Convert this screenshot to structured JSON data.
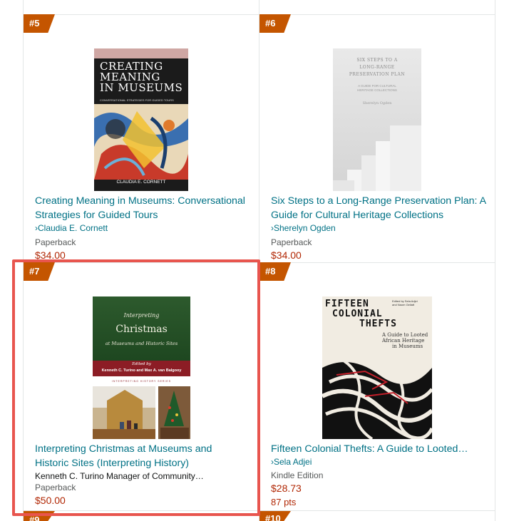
{
  "items": [
    {
      "rank": "#5",
      "title_line1": "Creating Meaning in Museums: Conversational",
      "title_line2": "Strategies for Guided Tours",
      "author": "Claudia E. Cornett",
      "format": "Paperback",
      "price": "$34.00",
      "cover": {
        "title_lines": [
          "CREATING",
          "MEANING",
          "IN MUSEUMS"
        ],
        "subtitle": "CONVERSATIONAL STRATEGIES FOR GUIDED TOURS",
        "author": "CLAUDIA E. CORNETT"
      }
    },
    {
      "rank": "#6",
      "title_line1": "Six Steps to a Long-Range Preservation Plan: A",
      "title_line2": "Guide for Cultural Heritage Collections",
      "author": "Sherelyn Ogden",
      "format": "Paperback",
      "price": "$34.00",
      "cover": {
        "title_lines": [
          "SIX STEPS TO A",
          "LONG-RANGE",
          "PRESERVATION PLAN"
        ],
        "subtitle_lines": [
          "A GUIDE FOR CULTURAL",
          "HERITAGE COLLECTIONS"
        ],
        "author": "Sherelyn Ogden"
      }
    },
    {
      "rank": "#7",
      "title_line1": "Interpreting Christmas at Museums and",
      "title_line2": "Historic Sites (Interpreting History)",
      "author": "Kenneth C. Turino Manager of Community…",
      "format": "Paperback",
      "price": "$50.00",
      "cover": {
        "top_line": "Interpreting",
        "main": "Christmas",
        "sub": "at Museums and Historic Sites",
        "edited": "Edited by",
        "editors": "Kenneth C. Turino and Max A. van Balgooy",
        "series": "INTERPRETING HISTORY SERIES"
      }
    },
    {
      "rank": "#8",
      "title_line1": "Fifteen Colonial Thefts: A Guide to Looted…",
      "author": "Sela Adjei",
      "format": "Kindle Edition",
      "price": "$28.73",
      "points": "87 pts",
      "cover": {
        "title_lines": [
          "FIFTEEN",
          "COLONIAL",
          "THEFTS"
        ],
        "edited": "Edited by Sela Adjei",
        "edited2": "and Naom Gellatt",
        "subtitle_lines": [
          "A Guide to Looted",
          "African Heritage",
          "in Museums"
        ]
      }
    }
  ],
  "partial_ranks": {
    "left": "#9",
    "right": "#10"
  },
  "colors": {
    "rank_badge": "#c45500",
    "link": "#007185",
    "price": "#b12704",
    "highlight": "#e8554e"
  }
}
